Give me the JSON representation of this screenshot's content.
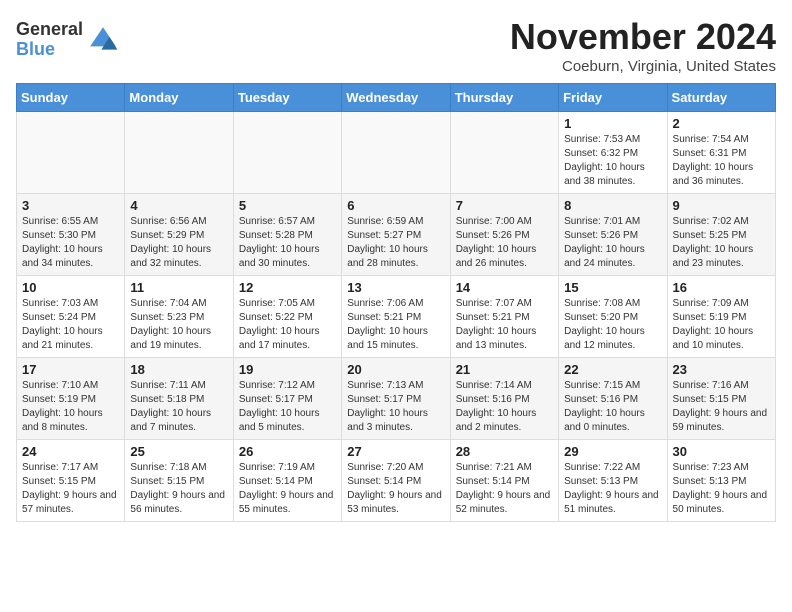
{
  "logo": {
    "general": "General",
    "blue": "Blue"
  },
  "title": "November 2024",
  "location": "Coeburn, Virginia, United States",
  "days_of_week": [
    "Sunday",
    "Monday",
    "Tuesday",
    "Wednesday",
    "Thursday",
    "Friday",
    "Saturday"
  ],
  "weeks": [
    [
      {
        "day": "",
        "info": ""
      },
      {
        "day": "",
        "info": ""
      },
      {
        "day": "",
        "info": ""
      },
      {
        "day": "",
        "info": ""
      },
      {
        "day": "",
        "info": ""
      },
      {
        "day": "1",
        "info": "Sunrise: 7:53 AM\nSunset: 6:32 PM\nDaylight: 10 hours and 38 minutes."
      },
      {
        "day": "2",
        "info": "Sunrise: 7:54 AM\nSunset: 6:31 PM\nDaylight: 10 hours and 36 minutes."
      }
    ],
    [
      {
        "day": "3",
        "info": "Sunrise: 6:55 AM\nSunset: 5:30 PM\nDaylight: 10 hours and 34 minutes."
      },
      {
        "day": "4",
        "info": "Sunrise: 6:56 AM\nSunset: 5:29 PM\nDaylight: 10 hours and 32 minutes."
      },
      {
        "day": "5",
        "info": "Sunrise: 6:57 AM\nSunset: 5:28 PM\nDaylight: 10 hours and 30 minutes."
      },
      {
        "day": "6",
        "info": "Sunrise: 6:59 AM\nSunset: 5:27 PM\nDaylight: 10 hours and 28 minutes."
      },
      {
        "day": "7",
        "info": "Sunrise: 7:00 AM\nSunset: 5:26 PM\nDaylight: 10 hours and 26 minutes."
      },
      {
        "day": "8",
        "info": "Sunrise: 7:01 AM\nSunset: 5:26 PM\nDaylight: 10 hours and 24 minutes."
      },
      {
        "day": "9",
        "info": "Sunrise: 7:02 AM\nSunset: 5:25 PM\nDaylight: 10 hours and 23 minutes."
      }
    ],
    [
      {
        "day": "10",
        "info": "Sunrise: 7:03 AM\nSunset: 5:24 PM\nDaylight: 10 hours and 21 minutes."
      },
      {
        "day": "11",
        "info": "Sunrise: 7:04 AM\nSunset: 5:23 PM\nDaylight: 10 hours and 19 minutes."
      },
      {
        "day": "12",
        "info": "Sunrise: 7:05 AM\nSunset: 5:22 PM\nDaylight: 10 hours and 17 minutes."
      },
      {
        "day": "13",
        "info": "Sunrise: 7:06 AM\nSunset: 5:21 PM\nDaylight: 10 hours and 15 minutes."
      },
      {
        "day": "14",
        "info": "Sunrise: 7:07 AM\nSunset: 5:21 PM\nDaylight: 10 hours and 13 minutes."
      },
      {
        "day": "15",
        "info": "Sunrise: 7:08 AM\nSunset: 5:20 PM\nDaylight: 10 hours and 12 minutes."
      },
      {
        "day": "16",
        "info": "Sunrise: 7:09 AM\nSunset: 5:19 PM\nDaylight: 10 hours and 10 minutes."
      }
    ],
    [
      {
        "day": "17",
        "info": "Sunrise: 7:10 AM\nSunset: 5:19 PM\nDaylight: 10 hours and 8 minutes."
      },
      {
        "day": "18",
        "info": "Sunrise: 7:11 AM\nSunset: 5:18 PM\nDaylight: 10 hours and 7 minutes."
      },
      {
        "day": "19",
        "info": "Sunrise: 7:12 AM\nSunset: 5:17 PM\nDaylight: 10 hours and 5 minutes."
      },
      {
        "day": "20",
        "info": "Sunrise: 7:13 AM\nSunset: 5:17 PM\nDaylight: 10 hours and 3 minutes."
      },
      {
        "day": "21",
        "info": "Sunrise: 7:14 AM\nSunset: 5:16 PM\nDaylight: 10 hours and 2 minutes."
      },
      {
        "day": "22",
        "info": "Sunrise: 7:15 AM\nSunset: 5:16 PM\nDaylight: 10 hours and 0 minutes."
      },
      {
        "day": "23",
        "info": "Sunrise: 7:16 AM\nSunset: 5:15 PM\nDaylight: 9 hours and 59 minutes."
      }
    ],
    [
      {
        "day": "24",
        "info": "Sunrise: 7:17 AM\nSunset: 5:15 PM\nDaylight: 9 hours and 57 minutes."
      },
      {
        "day": "25",
        "info": "Sunrise: 7:18 AM\nSunset: 5:15 PM\nDaylight: 9 hours and 56 minutes."
      },
      {
        "day": "26",
        "info": "Sunrise: 7:19 AM\nSunset: 5:14 PM\nDaylight: 9 hours and 55 minutes."
      },
      {
        "day": "27",
        "info": "Sunrise: 7:20 AM\nSunset: 5:14 PM\nDaylight: 9 hours and 53 minutes."
      },
      {
        "day": "28",
        "info": "Sunrise: 7:21 AM\nSunset: 5:14 PM\nDaylight: 9 hours and 52 minutes."
      },
      {
        "day": "29",
        "info": "Sunrise: 7:22 AM\nSunset: 5:13 PM\nDaylight: 9 hours and 51 minutes."
      },
      {
        "day": "30",
        "info": "Sunrise: 7:23 AM\nSunset: 5:13 PM\nDaylight: 9 hours and 50 minutes."
      }
    ]
  ]
}
